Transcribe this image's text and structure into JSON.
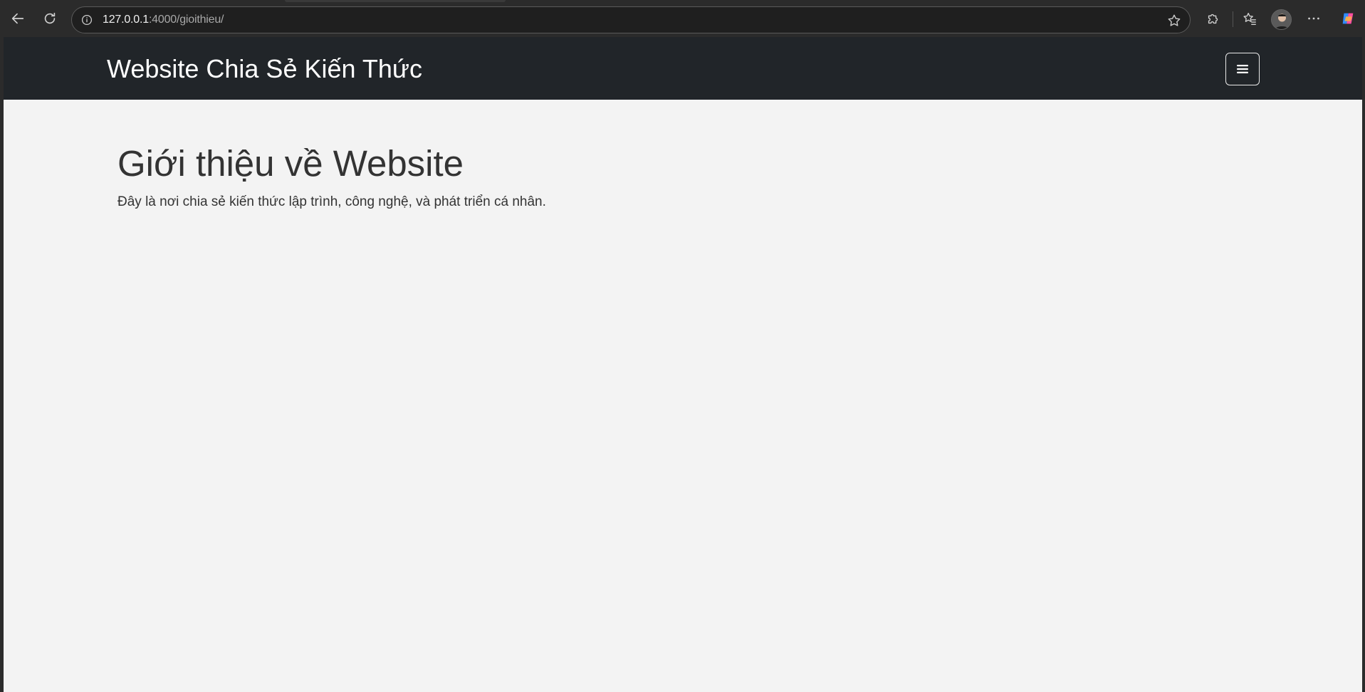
{
  "browser": {
    "url_host": "127.0.0.1",
    "url_path": ":4000/gioithieu/",
    "icons": {
      "back": "back-arrow-icon",
      "reload": "reload-icon",
      "site_info": "info-icon",
      "favorite": "star-icon",
      "extensions": "puzzle-icon",
      "favorites": "favorites-icon",
      "profile": "avatar",
      "more": "more-icon",
      "copilot": "copilot-icon"
    }
  },
  "site": {
    "brand": "Website Chia Sẻ Kiến Thức",
    "menu_icon": "hamburger-icon"
  },
  "main": {
    "title": "Giới thiệu về Website",
    "description": "Đây là nơi chia sẻ kiến thức lập trình, công nghệ, và phát triển cá nhân."
  },
  "colors": {
    "header_bg": "#212529",
    "page_bg": "#f3f3f3",
    "text": "#333333",
    "chrome_bg": "#2b2b2b"
  }
}
